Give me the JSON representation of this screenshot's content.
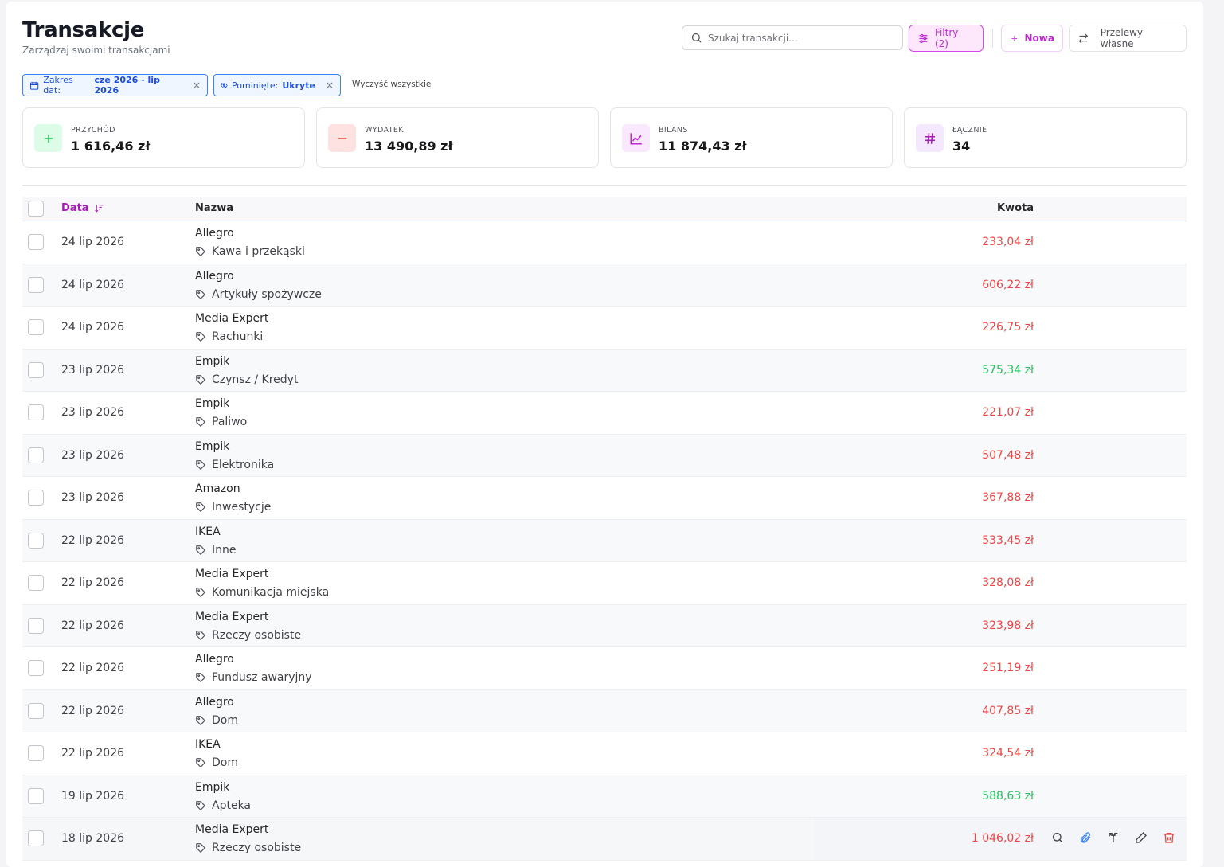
{
  "header": {
    "title": "Transakcje",
    "subtitle": "Zarządzaj swoimi transakcjami"
  },
  "toolbar": {
    "search_placeholder": "Szukaj transakcji...",
    "filters_label": "Filtry (2)",
    "new_label": "Nowa",
    "transfers_label": "Przelewy własne"
  },
  "chips": {
    "date_label": "Zakres dat:",
    "date_value": "cze 2026 - lip 2026",
    "omit_label": "Pominięte:",
    "omit_value": "Ukryte",
    "clear_all": "Wyczyść wszystkie"
  },
  "stats": [
    {
      "label": "PRZYCHÓD",
      "value": "1 616,46 zł",
      "icon": "plus-icon"
    },
    {
      "label": "WYDATEK",
      "value": "13 490,89 zł",
      "icon": "minus-icon"
    },
    {
      "label": "BILANS",
      "value": "11 874,43 zł",
      "icon": "chart-line-icon"
    },
    {
      "label": "ŁĄCZNIE",
      "value": "34",
      "icon": "hash-icon"
    }
  ],
  "table": {
    "columns": {
      "date": "Data",
      "name": "Nazwa",
      "amount": "Kwota"
    },
    "rows": [
      {
        "date": "24 lip 2026",
        "merchant": "Allegro",
        "category": "Kawa i przekąski",
        "amount": "233,04 zł",
        "type": "expense"
      },
      {
        "date": "24 lip 2026",
        "merchant": "Allegro",
        "category": "Artykuły spożywcze",
        "amount": "606,22 zł",
        "type": "expense"
      },
      {
        "date": "24 lip 2026",
        "merchant": "Media Expert",
        "category": "Rachunki",
        "amount": "226,75 zł",
        "type": "expense"
      },
      {
        "date": "23 lip 2026",
        "merchant": "Empik",
        "category": "Czynsz / Kredyt",
        "amount": "575,34 zł",
        "type": "income"
      },
      {
        "date": "23 lip 2026",
        "merchant": "Empik",
        "category": "Paliwo",
        "amount": "221,07 zł",
        "type": "expense"
      },
      {
        "date": "23 lip 2026",
        "merchant": "Empik",
        "category": "Elektronika",
        "amount": "507,48 zł",
        "type": "expense"
      },
      {
        "date": "23 lip 2026",
        "merchant": "Amazon",
        "category": "Inwestycje",
        "amount": "367,88 zł",
        "type": "expense"
      },
      {
        "date": "22 lip 2026",
        "merchant": "IKEA",
        "category": "Inne",
        "amount": "533,45 zł",
        "type": "expense"
      },
      {
        "date": "22 lip 2026",
        "merchant": "Media Expert",
        "category": "Komunikacja miejska",
        "amount": "328,08 zł",
        "type": "expense"
      },
      {
        "date": "22 lip 2026",
        "merchant": "Media Expert",
        "category": "Rzeczy osobiste",
        "amount": "323,98 zł",
        "type": "expense"
      },
      {
        "date": "22 lip 2026",
        "merchant": "Allegro",
        "category": "Fundusz awaryjny",
        "amount": "251,19 zł",
        "type": "expense"
      },
      {
        "date": "22 lip 2026",
        "merchant": "Allegro",
        "category": "Dom",
        "amount": "407,85 zł",
        "type": "expense"
      },
      {
        "date": "22 lip 2026",
        "merchant": "IKEA",
        "category": "Dom",
        "amount": "324,54 zł",
        "type": "expense"
      },
      {
        "date": "19 lip 2026",
        "merchant": "Empik",
        "category": "Apteka",
        "amount": "588,63 zł",
        "type": "income"
      },
      {
        "date": "18 lip 2026",
        "merchant": "Media Expert",
        "category": "Rzeczy osobiste",
        "amount": "1 046,02 zł",
        "type": "expense",
        "hovered": true
      }
    ]
  },
  "colors": {
    "accent": "#c026d3",
    "expense": "#ef4444",
    "income": "#22c55e",
    "chip": "#3b82f6"
  }
}
